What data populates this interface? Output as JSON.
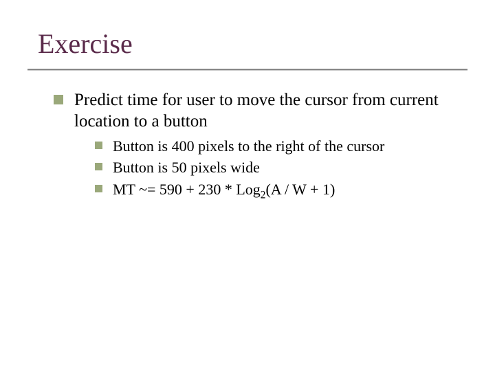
{
  "title": "Exercise",
  "main": {
    "text": "Predict time for user to move the cursor from current location to a button",
    "subs": [
      "Button is 400 pixels to the right of the cursor",
      "Button is 50 pixels wide"
    ],
    "formula": {
      "pre": "MT ~= 590 + 230 * Log",
      "sub": "2",
      "post": "(A / W + 1)"
    }
  }
}
